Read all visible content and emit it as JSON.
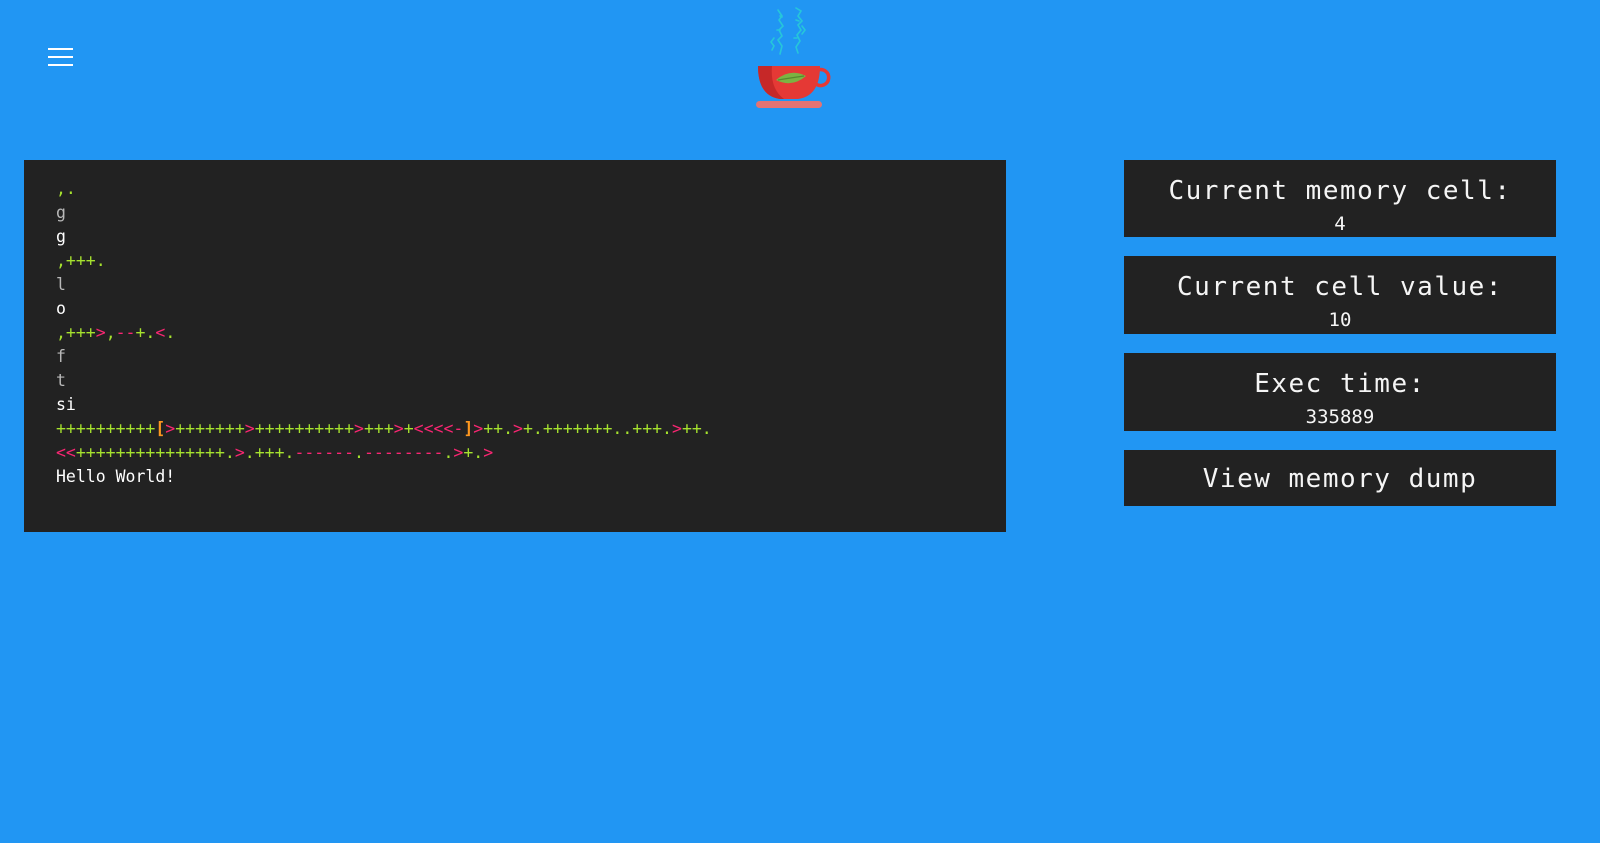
{
  "header": {
    "menu_icon": "hamburger-menu-icon",
    "logo_icon": "teacup-logo-icon"
  },
  "colors": {
    "background": "#2196f3",
    "panel": "#222222",
    "command_green": "#a6e22e",
    "command_pink": "#f92672",
    "bracket_orange": "#fd971f"
  },
  "editor": {
    "lines": [
      [
        {
          "t": ",.",
          "c": "t-in"
        }
      ],
      [
        {
          "t": "g",
          "c": "t-echo-dim"
        }
      ],
      [
        {
          "t": "g",
          "c": "t-echo"
        }
      ],
      [
        {
          "t": ",+++.",
          "c": "t-in"
        }
      ],
      [
        {
          "t": "l",
          "c": "t-echo-dim"
        }
      ],
      [
        {
          "t": "o",
          "c": "t-echo"
        }
      ],
      [
        {
          "t": ",+++",
          "c": "t-in"
        },
        {
          "t": ">",
          "c": "t-mv"
        },
        {
          "t": ",",
          "c": "t-in"
        },
        {
          "t": "--",
          "c": "t-dec"
        },
        {
          "t": "+.",
          "c": "t-inc"
        },
        {
          "t": "<",
          "c": "t-mv"
        },
        {
          "t": ".",
          "c": "t-out"
        }
      ],
      [
        {
          "t": "f",
          "c": "t-echo-dim"
        }
      ],
      [
        {
          "t": "t",
          "c": "t-echo-dim"
        }
      ],
      [
        {
          "t": "si",
          "c": "t-echo"
        }
      ],
      [
        {
          "t": "++++++++++",
          "c": "t-inc"
        },
        {
          "t": "[",
          "c": "t-br"
        },
        {
          "t": ">",
          "c": "t-mv"
        },
        {
          "t": "+++++++",
          "c": "t-inc"
        },
        {
          "t": ">",
          "c": "t-mv"
        },
        {
          "t": "++++++++++",
          "c": "t-inc"
        },
        {
          "t": ">",
          "c": "t-mv"
        },
        {
          "t": "+++",
          "c": "t-inc"
        },
        {
          "t": ">",
          "c": "t-mv"
        },
        {
          "t": "+",
          "c": "t-inc"
        },
        {
          "t": "<<<<",
          "c": "t-mv"
        },
        {
          "t": "-",
          "c": "t-dec"
        },
        {
          "t": "]",
          "c": "t-br"
        },
        {
          "t": ">",
          "c": "t-mv"
        },
        {
          "t": "++.",
          "c": "t-inc"
        },
        {
          "t": ">",
          "c": "t-mv"
        },
        {
          "t": "+.+++++++..+++.",
          "c": "t-inc"
        },
        {
          "t": ">",
          "c": "t-mv"
        },
        {
          "t": "++.",
          "c": "t-inc"
        }
      ],
      [
        {
          "t": "<<",
          "c": "t-mv"
        },
        {
          "t": "+++++++++++++++.",
          "c": "t-inc"
        },
        {
          "t": ">",
          "c": "t-mv"
        },
        {
          "t": ".+++.",
          "c": "t-inc"
        },
        {
          "t": "------",
          "c": "t-dec"
        },
        {
          "t": ".",
          "c": "t-out"
        },
        {
          "t": "--------",
          "c": "t-dec"
        },
        {
          "t": ".",
          "c": "t-out"
        },
        {
          "t": ">",
          "c": "t-mv"
        },
        {
          "t": "+.",
          "c": "t-inc"
        },
        {
          "t": ">",
          "c": "t-mv"
        }
      ],
      [
        {
          "t": "Hello World!",
          "c": "t-echo"
        }
      ]
    ]
  },
  "stats": {
    "memory_cell_label": "Current memory cell:",
    "memory_cell_value": "4",
    "cell_value_label": "Current cell value:",
    "cell_value_value": "10",
    "exec_time_label": "Exec time:",
    "exec_time_value": "335889",
    "memory_dump_button": "View memory dump"
  }
}
